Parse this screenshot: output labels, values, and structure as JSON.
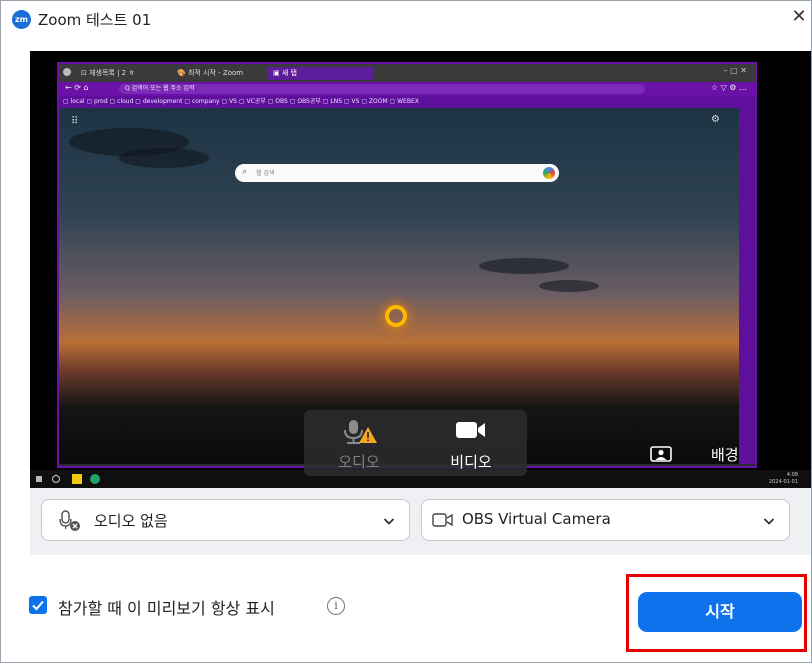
{
  "window": {
    "title": "Zoom 테스트 01",
    "logo_text": "zm",
    "close_glyph": "✕"
  },
  "preview": {
    "browser": {
      "tabs": [
        "⊡ 재생목록 | 2 ㅎ",
        "🎨 최적 시작 - Zoom",
        "▣ 새 탭"
      ],
      "address": "Q  검색어 또는 웹 주소 입력",
      "bookmarks": "▢ local  ▢ prod  ▢ cloud  ▢ development  ▢ company  ▢ VS  ▢ VC공부  ▢ OBS  ▢ OBS공부  ▢ LNS  ▢ VS  ▢ ZOOM  ▢ WEBEX",
      "search_placeholder": "웹 검색"
    },
    "taskbar_clock": [
      "4:08",
      "2024-01-01"
    ],
    "audio": {
      "label": "오디오",
      "icon": "mic-warning-icon",
      "enabled": false
    },
    "video": {
      "label": "비디오",
      "icon": "video-camera-icon",
      "enabled": true
    },
    "background": {
      "label": "배경",
      "icon": "background-portrait-icon"
    }
  },
  "audio_select": {
    "value": "오디오 없음",
    "icon": "mic-muted-icon"
  },
  "video_select": {
    "value": "OBS Virtual Camera",
    "icon": "camera-outline-icon"
  },
  "footer": {
    "always_show_label": "참가할 때 이 미리보기 항상 표시",
    "always_show_checked": true,
    "start_label": "시작"
  },
  "colors": {
    "accent": "#0e72ed",
    "highlight": "#e60000",
    "browser_accent": "#6a12a8"
  }
}
